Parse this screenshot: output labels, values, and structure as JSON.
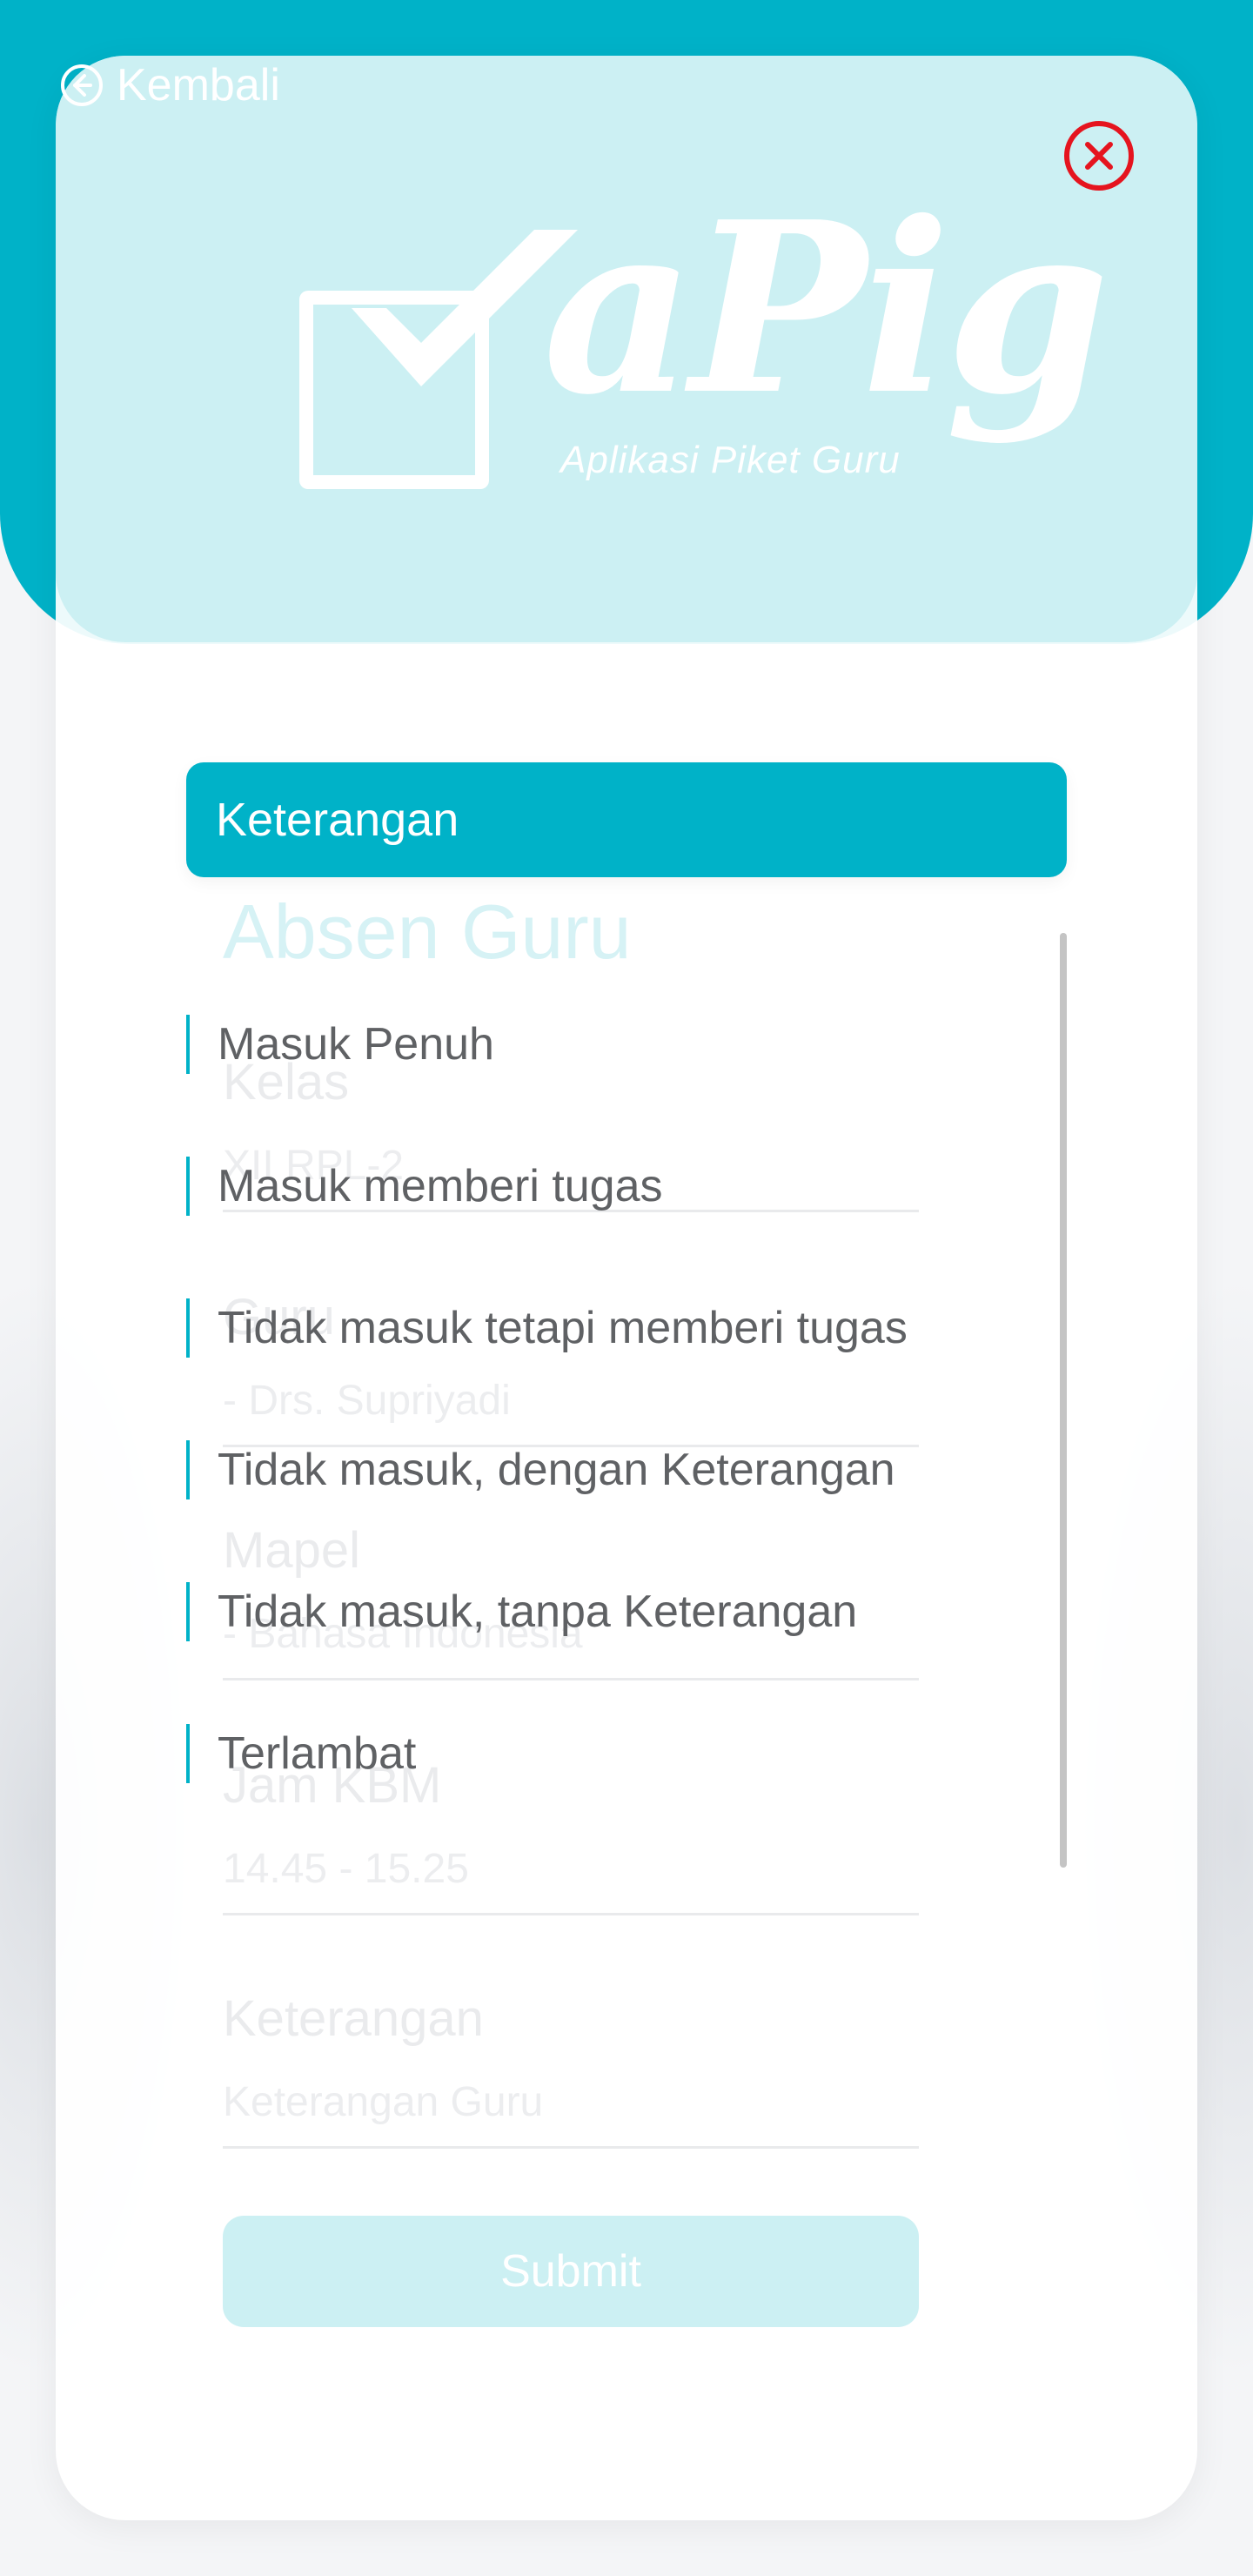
{
  "nav": {
    "back_label": "Kembali"
  },
  "logo": {
    "wordmark": "aPig",
    "tagline": "Aplikasi Piket Guru"
  },
  "form": {
    "title": "Absen Guru",
    "fields": [
      {
        "label": "Kelas",
        "value": "XII RPL-2"
      },
      {
        "label": "Guru",
        "value": "- Drs. Supriyadi"
      },
      {
        "label": "Mapel",
        "value": "- Bahasa Indonesia"
      },
      {
        "label": "Jam KBM",
        "value": "14.45 - 15.25"
      },
      {
        "label": "Keterangan",
        "placeholder": "Keterangan Guru"
      }
    ],
    "submit_label": "Submit"
  },
  "dropdown": {
    "header": "Keterangan",
    "options": [
      "Masuk Penuh",
      "Masuk memberi tugas",
      "Tidak masuk tetapi memberi tugas",
      "Tidak masuk, dengan Keterangan",
      "Tidak masuk, tanpa Keterangan",
      "Terlambat"
    ]
  },
  "colors": {
    "primary": "#00b2c8",
    "header_light": "#ccf0f3",
    "close_red": "#e5141e",
    "option_text": "#5f6164"
  }
}
